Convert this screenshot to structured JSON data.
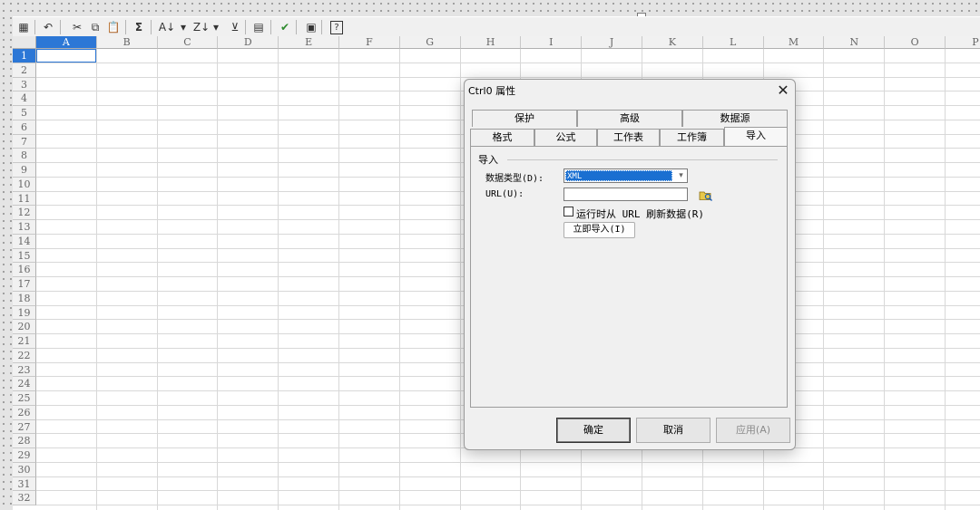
{
  "toolbar": {
    "items": [
      {
        "name": "properties-icon",
        "glyph": "▦"
      },
      {
        "name": "undo-icon",
        "glyph": "↶"
      },
      {
        "name": "cut-icon",
        "glyph": "✂"
      },
      {
        "name": "copy-icon",
        "glyph": "⧉"
      },
      {
        "name": "paste-icon",
        "glyph": "📋"
      },
      {
        "name": "autosum-icon",
        "glyph": "Σ"
      },
      {
        "name": "sort-ascending-icon",
        "glyph": "A↓"
      },
      {
        "name": "sort-ascending-dropdown-icon",
        "glyph": "▾"
      },
      {
        "name": "sort-descending-icon",
        "glyph": "Z↓"
      },
      {
        "name": "sort-descending-dropdown-icon",
        "glyph": "▾"
      },
      {
        "name": "filter-icon",
        "glyph": "⊻"
      },
      {
        "name": "protect-icon",
        "glyph": "▤"
      },
      {
        "name": "recalc-icon",
        "glyph": "✔"
      },
      {
        "name": "export-icon",
        "glyph": "▣"
      },
      {
        "name": "help-icon",
        "glyph": "?"
      }
    ]
  },
  "sheet": {
    "columns": [
      "A",
      "B",
      "C",
      "D",
      "E",
      "F",
      "G",
      "H",
      "I",
      "J",
      "K",
      "L",
      "M",
      "N",
      "O",
      "P"
    ],
    "rows": [
      "1",
      "2",
      "3",
      "4",
      "5",
      "6",
      "7",
      "8",
      "9",
      "10",
      "11",
      "12",
      "13",
      "14",
      "15",
      "16",
      "17",
      "18",
      "19",
      "20",
      "21",
      "22",
      "23",
      "24",
      "25",
      "26",
      "27",
      "28",
      "29",
      "30",
      "31",
      "32"
    ],
    "selected_column": "A",
    "selected_row": "1"
  },
  "dialog": {
    "title": "Ctrl0 属性",
    "close_glyph": "✕",
    "tabs_top": [
      "保护",
      "高级",
      "数据源"
    ],
    "tabs_bottom": [
      "格式",
      "公式",
      "工作表",
      "工作簿",
      "导入"
    ],
    "active_tab": "导入",
    "group_title": "导入",
    "data_type_label": "数据类型(D):",
    "data_type_value": "XML",
    "url_label": "URL(U):",
    "url_value": "",
    "refresh_label": "运行时从 URL 刷新数据(R)",
    "refresh_checked": false,
    "import_now_label": "立即导入(I)",
    "ok_label": "确定",
    "cancel_label": "取消",
    "apply_label": "应用(A)"
  },
  "colors": {
    "selection": "#2c77d6",
    "dropdown_highlight": "#1a6fd1"
  }
}
